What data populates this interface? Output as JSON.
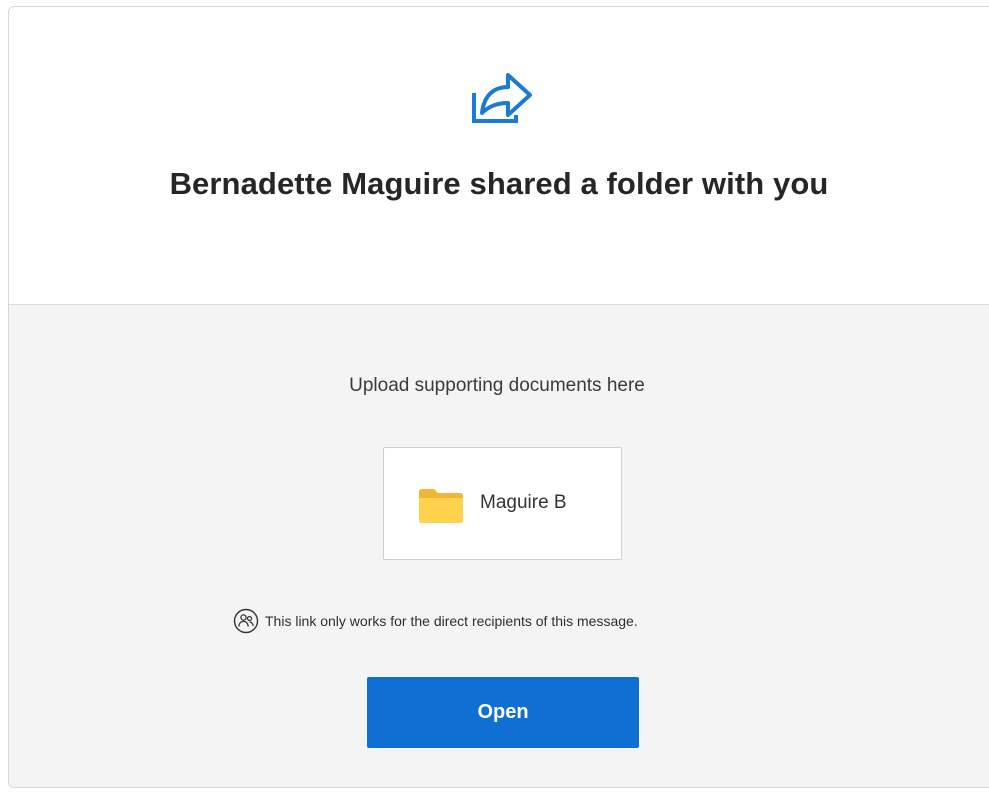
{
  "header": {
    "icon": "share-arrow-icon",
    "title": "Bernadette Maguire shared a folder with you"
  },
  "body": {
    "message": "Upload supporting documents here",
    "folder": {
      "icon": "folder-icon",
      "name": "Maguire B"
    },
    "notice": {
      "icon": "people-icon",
      "text": "This link only works for the direct recipients of this message."
    },
    "open_label": "Open"
  },
  "colors": {
    "accent": "#0f6fd3",
    "icon_blue": "#1a7ad4",
    "folder_yellow": "#ffd24d",
    "body_background": "#f4f4f4"
  }
}
